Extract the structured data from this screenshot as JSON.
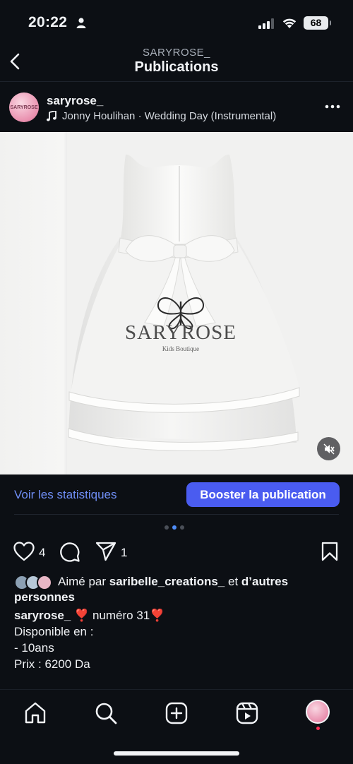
{
  "status_bar": {
    "time": "20:22",
    "battery": "68"
  },
  "header": {
    "account": "SARYROSE_",
    "title": "Publications"
  },
  "post": {
    "username": "saryrose_",
    "audio": "Jonny Houlihan · Wedding Day (Instrumental)",
    "watermark_brand": "SARYROSE",
    "watermark_tagline": "Kids Boutique",
    "avatar_text": "SARYROSE"
  },
  "actions_strip": {
    "stats_label": "Voir les statistiques",
    "boost_label": "Booster la publication"
  },
  "carousel": {
    "count": 3,
    "active": 1
  },
  "engagement": {
    "likes_count": "4",
    "shares_count": "1"
  },
  "likes": {
    "prefix": "Aimé par",
    "user": "saribelle_creations_",
    "connector": "et",
    "suffix": "d’autres personnes"
  },
  "caption": {
    "username": "saryrose_",
    "first_line": " ❣️ numéro 31❣️",
    "lines": [
      "Disponible en :",
      "- 10ans",
      "",
      "Prix : 6200 Da"
    ]
  },
  "colors": {
    "accent_link": "#6f8ef5",
    "boost_button": "#4a5cf0",
    "background": "#0c0f14"
  }
}
